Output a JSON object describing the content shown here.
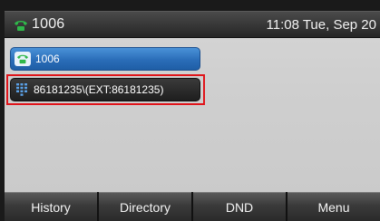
{
  "status_bar": {
    "account": "1006",
    "clock": "11:08 Tue, Sep 20",
    "icon": "phone-handset-icon"
  },
  "line_keys": [
    {
      "label": "1006",
      "icon": "phone-handset-icon",
      "state": "selected"
    },
    {
      "label": "86181235\\(EXT:86181235)",
      "icon": "dialpad-icon",
      "state": "normal"
    }
  ],
  "softkeys": [
    {
      "label": "History"
    },
    {
      "label": "Directory"
    },
    {
      "label": "DND"
    },
    {
      "label": "Menu"
    }
  ],
  "colors": {
    "accent": "#2a6db8",
    "highlight": "#e0141a",
    "phone_icon": "#2fb84a"
  }
}
